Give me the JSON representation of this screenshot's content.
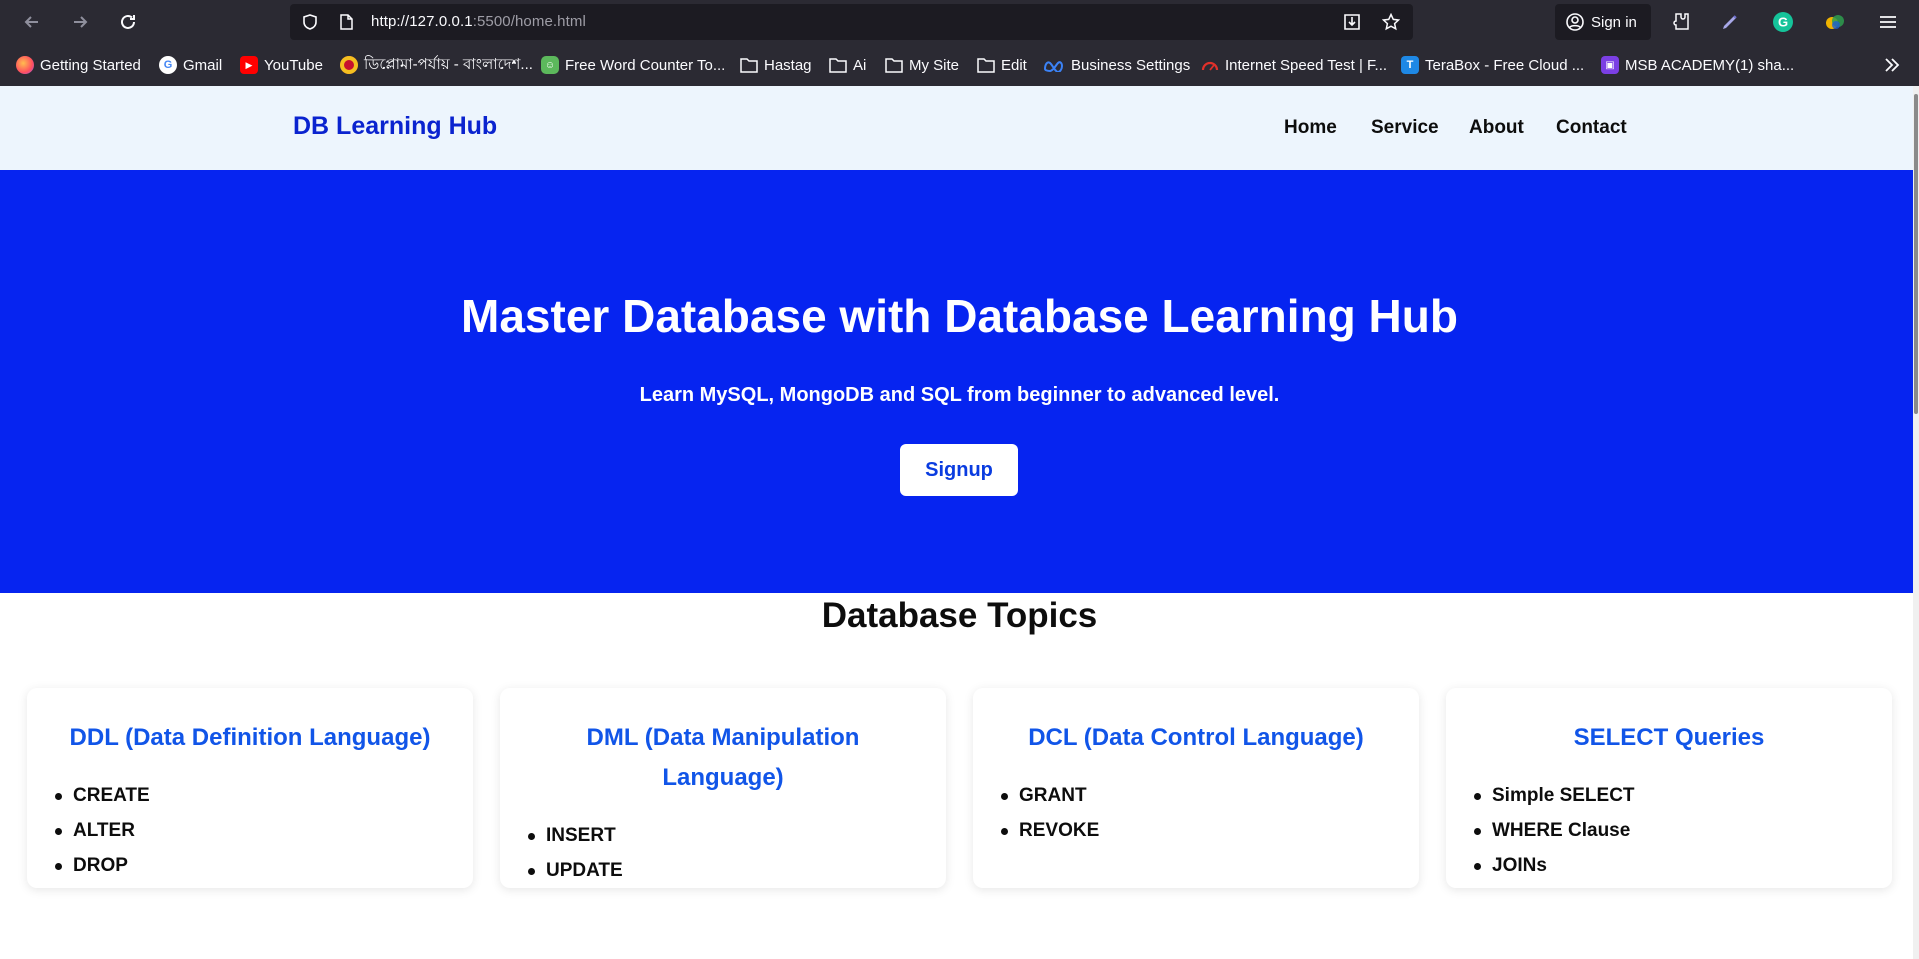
{
  "browser": {
    "url_host": "http://127.0.0.1",
    "url_path": ":5500/home.html",
    "signin_label": "Sign in",
    "bookmarks": [
      {
        "label": "Getting Started",
        "icon": "firefox-icon"
      },
      {
        "label": "Gmail",
        "icon": "google-icon"
      },
      {
        "label": "YouTube",
        "icon": "youtube-icon"
      },
      {
        "label": "ডিপ্লোমা-পর্যায় - বাংলাদেশ...",
        "icon": "bd-gov-icon"
      },
      {
        "label": "Free Word Counter To...",
        "icon": "robot-icon"
      },
      {
        "label": "Hastag",
        "icon": "folder-icon"
      },
      {
        "label": "Ai",
        "icon": "folder-icon"
      },
      {
        "label": "My Site",
        "icon": "folder-icon"
      },
      {
        "label": "Edit",
        "icon": "folder-icon"
      },
      {
        "label": "Business Settings",
        "icon": "meta-icon"
      },
      {
        "label": "Internet Speed Test | F...",
        "icon": "speedometer-icon"
      },
      {
        "label": "TeraBox - Free Cloud ...",
        "icon": "terabox-icon"
      },
      {
        "label": "MSB ACADEMY(1) sha...",
        "icon": "msb-icon"
      }
    ]
  },
  "site": {
    "brand": "DB Learning Hub",
    "menu": [
      "Home",
      "Service",
      "About",
      "Contact"
    ]
  },
  "hero": {
    "title": "Master Database with Database Learning Hub",
    "subtitle": "Learn MySQL, MongoDB and SQL from beginner to advanced level.",
    "cta": "Signup"
  },
  "topics": {
    "title": "Database Topics",
    "cards": [
      {
        "title": "DDL (Data Definition Language)",
        "items": [
          "CREATE",
          "ALTER",
          "DROP"
        ]
      },
      {
        "title": "DML (Data Manipulation Language)",
        "items": [
          "INSERT",
          "UPDATE"
        ]
      },
      {
        "title": "DCL (Data Control Language)",
        "items": [
          "GRANT",
          "REVOKE"
        ]
      },
      {
        "title": "SELECT Queries",
        "items": [
          "Simple SELECT",
          "WHERE Clause",
          "JOINs"
        ]
      }
    ]
  },
  "colors": {
    "hero_bg": "#0624f0",
    "brand": "#0a23cf",
    "card_title": "#1155e8",
    "nav_bg": "#edf5fd"
  }
}
